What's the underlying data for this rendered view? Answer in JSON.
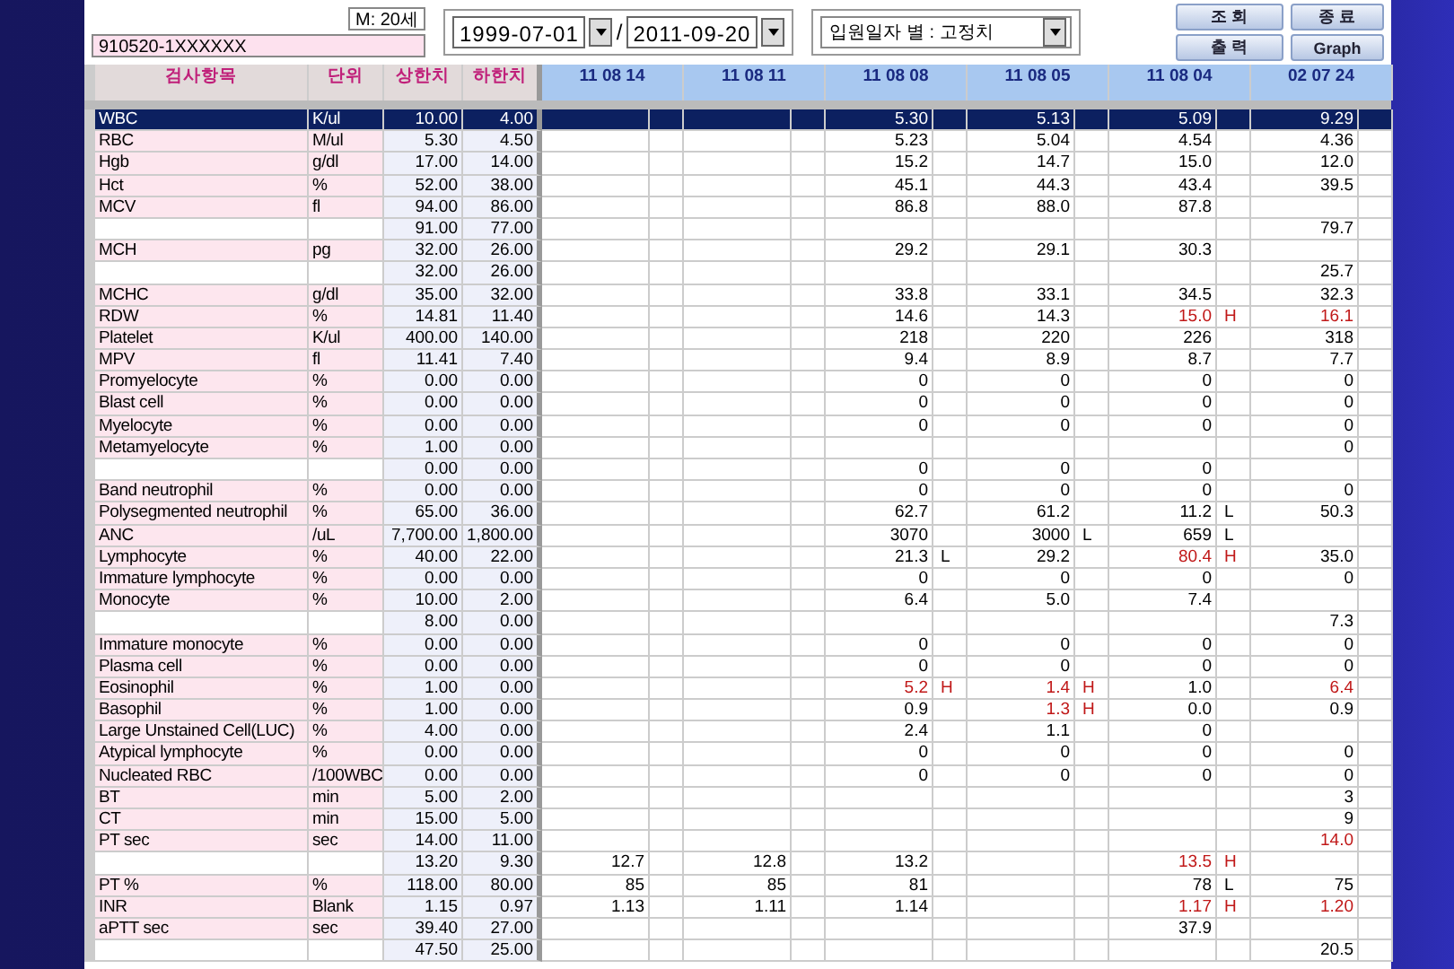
{
  "patient": {
    "sex_age": "M: 20세",
    "id_number": "910520-1XXXXXX"
  },
  "date_range": {
    "from": "1999-07-01",
    "separator": "/",
    "to": "2011-09-20"
  },
  "view_select": {
    "value": "입원일자 별 : 고정치"
  },
  "buttons": [
    {
      "label": "조 회"
    },
    {
      "label": "종 료"
    },
    {
      "label": "출 력"
    },
    {
      "label": "Graph"
    }
  ],
  "table": {
    "columns": [
      "검사항목",
      "단위",
      "상한치",
      "하한치"
    ],
    "dates": [
      "11 08 14",
      "11 08 11",
      "11 08 08",
      "11 08 05",
      "11 08 04",
      "02 07 24"
    ],
    "rows": [
      {
        "name": "WBC",
        "unit": "K/ul",
        "upper": "10.00",
        "lower": "4.00",
        "selected": true,
        "results": [
          {
            "kind": "blank"
          },
          {
            "kind": "blank"
          },
          {
            "kind": "value",
            "value": "5.30",
            "abnormal": false
          },
          {
            "kind": "value",
            "value": "5.13",
            "abnormal": false
          },
          {
            "kind": "value",
            "value": "5.09",
            "abnormal": false
          },
          {
            "kind": "value",
            "value": "9.29",
            "abnormal": false
          }
        ]
      },
      {
        "name": "RBC",
        "unit": "M/ul",
        "upper": "5.30",
        "lower": "4.50",
        "selected": false,
        "results": [
          {
            "kind": "blank"
          },
          {
            "kind": "blank"
          },
          {
            "kind": "value",
            "value": "5.23",
            "abnormal": false
          },
          {
            "kind": "value",
            "value": "5.04",
            "abnormal": false
          },
          {
            "kind": "value",
            "value": "4.54",
            "abnormal": false
          },
          {
            "kind": "value",
            "value": "4.36",
            "abnormal": false
          }
        ]
      },
      {
        "name": "Hgb",
        "unit": "g/dl",
        "upper": "17.00",
        "lower": "14.00",
        "selected": false,
        "results": [
          {
            "kind": "blank"
          },
          {
            "kind": "blank"
          },
          {
            "kind": "value",
            "value": "15.2",
            "abnormal": false
          },
          {
            "kind": "value",
            "value": "14.7",
            "abnormal": false
          },
          {
            "kind": "value",
            "value": "15.0",
            "abnormal": false
          },
          {
            "kind": "value",
            "value": "12.0",
            "abnormal": false
          }
        ]
      },
      {
        "name": "Hct",
        "unit": "%",
        "upper": "52.00",
        "lower": "38.00",
        "selected": false,
        "results": [
          {
            "kind": "blank"
          },
          {
            "kind": "blank"
          },
          {
            "kind": "value",
            "value": "45.1",
            "abnormal": false
          },
          {
            "kind": "value",
            "value": "44.3",
            "abnormal": false
          },
          {
            "kind": "value",
            "value": "43.4",
            "abnormal": false
          },
          {
            "kind": "value",
            "value": "39.5",
            "abnormal": false
          }
        ]
      },
      {
        "name": "MCV",
        "unit": "fl",
        "upper": "94.00",
        "lower": "86.00",
        "selected": false,
        "results": [
          {
            "kind": "blank"
          },
          {
            "kind": "blank"
          },
          {
            "kind": "value",
            "value": "86.8",
            "abnormal": false
          },
          {
            "kind": "value",
            "value": "88.0",
            "abnormal": false
          },
          {
            "kind": "value",
            "value": "87.8",
            "abnormal": false
          },
          {
            "kind": "blank"
          }
        ]
      },
      {
        "upper": "91.00",
        "lower": "77.00",
        "selected": false,
        "results": [
          {
            "kind": "blank"
          },
          {
            "kind": "blank"
          },
          {
            "kind": "blank"
          },
          {
            "kind": "blank"
          },
          {
            "kind": "blank"
          },
          {
            "kind": "value",
            "value": "79.7",
            "abnormal": false
          }
        ]
      },
      {
        "name": "MCH",
        "unit": "pg",
        "upper": "32.00",
        "lower": "26.00",
        "selected": false,
        "results": [
          {
            "kind": "blank"
          },
          {
            "kind": "blank"
          },
          {
            "kind": "value",
            "value": "29.2",
            "abnormal": false
          },
          {
            "kind": "value",
            "value": "29.1",
            "abnormal": false
          },
          {
            "kind": "value",
            "value": "30.3",
            "abnormal": false
          },
          {
            "kind": "blank"
          }
        ]
      },
      {
        "upper": "32.00",
        "lower": "26.00",
        "selected": false,
        "results": [
          {
            "kind": "blank"
          },
          {
            "kind": "blank"
          },
          {
            "kind": "blank"
          },
          {
            "kind": "blank"
          },
          {
            "kind": "blank"
          },
          {
            "kind": "value",
            "value": "25.7",
            "abnormal": false
          }
        ]
      },
      {
        "name": "MCHC",
        "unit": "g/dl",
        "upper": "35.00",
        "lower": "32.00",
        "selected": false,
        "results": [
          {
            "kind": "blank"
          },
          {
            "kind": "blank"
          },
          {
            "kind": "value",
            "value": "33.8",
            "abnormal": false
          },
          {
            "kind": "value",
            "value": "33.1",
            "abnormal": false
          },
          {
            "kind": "value",
            "value": "34.5",
            "abnormal": false
          },
          {
            "kind": "value",
            "value": "32.3",
            "abnormal": false
          }
        ]
      },
      {
        "name": "RDW",
        "unit": "%",
        "upper": "14.81",
        "lower": "11.40",
        "selected": false,
        "results": [
          {
            "kind": "blank"
          },
          {
            "kind": "blank"
          },
          {
            "kind": "value",
            "value": "14.6",
            "abnormal": false
          },
          {
            "kind": "value",
            "value": "14.3",
            "abnormal": false
          },
          {
            "kind": "value",
            "value": "15.0",
            "flag": "H",
            "abnormal": true
          },
          {
            "kind": "value",
            "value": "16.1",
            "abnormal": true
          }
        ]
      },
      {
        "name": "Platelet",
        "unit": "K/ul",
        "upper": "400.00",
        "lower": "140.00",
        "selected": false,
        "results": [
          {
            "kind": "blank"
          },
          {
            "kind": "blank"
          },
          {
            "kind": "value",
            "value": "218",
            "abnormal": false
          },
          {
            "kind": "value",
            "value": "220",
            "abnormal": false
          },
          {
            "kind": "value",
            "value": "226",
            "abnormal": false
          },
          {
            "kind": "value",
            "value": "318",
            "abnormal": false
          }
        ]
      },
      {
        "name": "MPV",
        "unit": "fl",
        "upper": "11.41",
        "lower": "7.40",
        "selected": false,
        "results": [
          {
            "kind": "blank"
          },
          {
            "kind": "blank"
          },
          {
            "kind": "value",
            "value": "9.4",
            "abnormal": false
          },
          {
            "kind": "value",
            "value": "8.9",
            "abnormal": false
          },
          {
            "kind": "value",
            "value": "8.7",
            "abnormal": false
          },
          {
            "kind": "value",
            "value": "7.7",
            "abnormal": false
          }
        ]
      },
      {
        "name": "Promyelocyte",
        "unit": "%",
        "upper": "0.00",
        "lower": "0.00",
        "selected": false,
        "results": [
          {
            "kind": "blank"
          },
          {
            "kind": "blank"
          },
          {
            "kind": "value",
            "value": "0",
            "abnormal": false
          },
          {
            "kind": "value",
            "value": "0",
            "abnormal": false
          },
          {
            "kind": "value",
            "value": "0",
            "abnormal": false
          },
          {
            "kind": "value",
            "value": "0",
            "abnormal": false
          }
        ]
      },
      {
        "name": "Blast cell",
        "unit": "%",
        "upper": "0.00",
        "lower": "0.00",
        "selected": false,
        "results": [
          {
            "kind": "blank"
          },
          {
            "kind": "blank"
          },
          {
            "kind": "value",
            "value": "0",
            "abnormal": false
          },
          {
            "kind": "value",
            "value": "0",
            "abnormal": false
          },
          {
            "kind": "value",
            "value": "0",
            "abnormal": false
          },
          {
            "kind": "value",
            "value": "0",
            "abnormal": false
          }
        ]
      },
      {
        "name": "Myelocyte",
        "unit": "%",
        "upper": "0.00",
        "lower": "0.00",
        "selected": false,
        "results": [
          {
            "kind": "blank"
          },
          {
            "kind": "blank"
          },
          {
            "kind": "value",
            "value": "0",
            "abnormal": false
          },
          {
            "kind": "value",
            "value": "0",
            "abnormal": false
          },
          {
            "kind": "value",
            "value": "0",
            "abnormal": false
          },
          {
            "kind": "value",
            "value": "0",
            "abnormal": false
          }
        ]
      },
      {
        "name": "Metamyelocyte",
        "unit": "%",
        "upper": "1.00",
        "lower": "0.00",
        "selected": false,
        "results": [
          {
            "kind": "blank"
          },
          {
            "kind": "blank"
          },
          {
            "kind": "blank"
          },
          {
            "kind": "blank"
          },
          {
            "kind": "blank"
          },
          {
            "kind": "value",
            "value": "0",
            "abnormal": false
          }
        ]
      },
      {
        "upper": "0.00",
        "lower": "0.00",
        "selected": false,
        "results": [
          {
            "kind": "blank"
          },
          {
            "kind": "blank"
          },
          {
            "kind": "value",
            "value": "0",
            "abnormal": false
          },
          {
            "kind": "value",
            "value": "0",
            "abnormal": false
          },
          {
            "kind": "value",
            "value": "0",
            "abnormal": false
          },
          {
            "kind": "blank"
          }
        ]
      },
      {
        "name": "Band neutrophil",
        "unit": "%",
        "upper": "0.00",
        "lower": "0.00",
        "selected": false,
        "results": [
          {
            "kind": "blank"
          },
          {
            "kind": "blank"
          },
          {
            "kind": "value",
            "value": "0",
            "abnormal": false
          },
          {
            "kind": "value",
            "value": "0",
            "abnormal": false
          },
          {
            "kind": "value",
            "value": "0",
            "abnormal": false
          },
          {
            "kind": "value",
            "value": "0",
            "abnormal": false
          }
        ]
      },
      {
        "name": "Polysegmented neutrophil",
        "unit": "%",
        "upper": "65.00",
        "lower": "36.00",
        "selected": false,
        "results": [
          {
            "kind": "blank"
          },
          {
            "kind": "blank"
          },
          {
            "kind": "value",
            "value": "62.7",
            "abnormal": false
          },
          {
            "kind": "value",
            "value": "61.2",
            "abnormal": false
          },
          {
            "kind": "value",
            "value": "11.2",
            "flag": "L",
            "abnormal": false
          },
          {
            "kind": "value",
            "value": "50.3",
            "abnormal": false
          }
        ]
      },
      {
        "name": "ANC",
        "unit": "/uL",
        "upper": "7,700.00",
        "lower": "1,800.00",
        "selected": false,
        "results": [
          {
            "kind": "blank"
          },
          {
            "kind": "blank"
          },
          {
            "kind": "value",
            "value": "3070",
            "abnormal": false
          },
          {
            "kind": "value",
            "value": "3000",
            "flag": "L",
            "abnormal": false
          },
          {
            "kind": "value",
            "value": "659",
            "flag": "L",
            "abnormal": false
          },
          {
            "kind": "blank"
          }
        ]
      },
      {
        "name": "Lymphocyte",
        "unit": "%",
        "upper": "40.00",
        "lower": "22.00",
        "selected": false,
        "results": [
          {
            "kind": "blank"
          },
          {
            "kind": "blank"
          },
          {
            "kind": "value",
            "value": "21.3",
            "flag": "L",
            "abnormal": false
          },
          {
            "kind": "value",
            "value": "29.2",
            "abnormal": false
          },
          {
            "kind": "value",
            "value": "80.4",
            "flag": "H",
            "abnormal": true
          },
          {
            "kind": "value",
            "value": "35.0",
            "abnormal": false
          }
        ]
      },
      {
        "name": "Immature lymphocyte",
        "unit": "%",
        "upper": "0.00",
        "lower": "0.00",
        "selected": false,
        "results": [
          {
            "kind": "blank"
          },
          {
            "kind": "blank"
          },
          {
            "kind": "value",
            "value": "0",
            "abnormal": false
          },
          {
            "kind": "value",
            "value": "0",
            "abnormal": false
          },
          {
            "kind": "value",
            "value": "0",
            "abnormal": false
          },
          {
            "kind": "value",
            "value": "0",
            "abnormal": false
          }
        ]
      },
      {
        "name": "Monocyte",
        "unit": "%",
        "upper": "10.00",
        "lower": "2.00",
        "selected": false,
        "results": [
          {
            "kind": "blank"
          },
          {
            "kind": "blank"
          },
          {
            "kind": "value",
            "value": "6.4",
            "abnormal": false
          },
          {
            "kind": "value",
            "value": "5.0",
            "abnormal": false
          },
          {
            "kind": "value",
            "value": "7.4",
            "abnormal": false
          },
          {
            "kind": "blank"
          }
        ]
      },
      {
        "upper": "8.00",
        "lower": "0.00",
        "selected": false,
        "results": [
          {
            "kind": "blank"
          },
          {
            "kind": "blank"
          },
          {
            "kind": "blank"
          },
          {
            "kind": "blank"
          },
          {
            "kind": "blank"
          },
          {
            "kind": "value",
            "value": "7.3",
            "abnormal": false
          }
        ]
      },
      {
        "name": "Immature monocyte",
        "unit": "%",
        "upper": "0.00",
        "lower": "0.00",
        "selected": false,
        "results": [
          {
            "kind": "blank"
          },
          {
            "kind": "blank"
          },
          {
            "kind": "value",
            "value": "0",
            "abnormal": false
          },
          {
            "kind": "value",
            "value": "0",
            "abnormal": false
          },
          {
            "kind": "value",
            "value": "0",
            "abnormal": false
          },
          {
            "kind": "value",
            "value": "0",
            "abnormal": false
          }
        ]
      },
      {
        "name": "Plasma cell",
        "unit": "%",
        "upper": "0.00",
        "lower": "0.00",
        "selected": false,
        "results": [
          {
            "kind": "blank"
          },
          {
            "kind": "blank"
          },
          {
            "kind": "value",
            "value": "0",
            "abnormal": false
          },
          {
            "kind": "value",
            "value": "0",
            "abnormal": false
          },
          {
            "kind": "value",
            "value": "0",
            "abnormal": false
          },
          {
            "kind": "value",
            "value": "0",
            "abnormal": false
          }
        ]
      },
      {
        "name": "Eosinophil",
        "unit": "%",
        "upper": "1.00",
        "lower": "0.00",
        "selected": false,
        "results": [
          {
            "kind": "blank"
          },
          {
            "kind": "blank"
          },
          {
            "kind": "value",
            "value": "5.2",
            "flag": "H",
            "abnormal": true
          },
          {
            "kind": "value",
            "value": "1.4",
            "flag": "H",
            "abnormal": true
          },
          {
            "kind": "value",
            "value": "1.0",
            "abnormal": false
          },
          {
            "kind": "value",
            "value": "6.4",
            "abnormal": true
          }
        ]
      },
      {
        "name": "Basophil",
        "unit": "%",
        "upper": "1.00",
        "lower": "0.00",
        "selected": false,
        "results": [
          {
            "kind": "blank"
          },
          {
            "kind": "blank"
          },
          {
            "kind": "value",
            "value": "0.9",
            "abnormal": false
          },
          {
            "kind": "value",
            "value": "1.3",
            "flag": "H",
            "abnormal": true
          },
          {
            "kind": "value",
            "value": "0.0",
            "abnormal": false
          },
          {
            "kind": "value",
            "value": "0.9",
            "abnormal": false
          }
        ]
      },
      {
        "name": "Large Unstained Cell(LUC)",
        "unit": "%",
        "upper": "4.00",
        "lower": "0.00",
        "selected": false,
        "results": [
          {
            "kind": "blank"
          },
          {
            "kind": "blank"
          },
          {
            "kind": "value",
            "value": "2.4",
            "abnormal": false
          },
          {
            "kind": "value",
            "value": "1.1",
            "abnormal": false
          },
          {
            "kind": "value",
            "value": "0",
            "abnormal": false
          },
          {
            "kind": "blank"
          }
        ]
      },
      {
        "name": "Atypical lymphocyte",
        "unit": "%",
        "upper": "0.00",
        "lower": "0.00",
        "selected": false,
        "results": [
          {
            "kind": "blank"
          },
          {
            "kind": "blank"
          },
          {
            "kind": "value",
            "value": "0",
            "abnormal": false
          },
          {
            "kind": "value",
            "value": "0",
            "abnormal": false
          },
          {
            "kind": "value",
            "value": "0",
            "abnormal": false
          },
          {
            "kind": "value",
            "value": "0",
            "abnormal": false
          }
        ]
      },
      {
        "name": "Nucleated RBC",
        "unit": "/100WBC",
        "upper": "0.00",
        "lower": "0.00",
        "selected": false,
        "results": [
          {
            "kind": "blank"
          },
          {
            "kind": "blank"
          },
          {
            "kind": "value",
            "value": "0",
            "abnormal": false
          },
          {
            "kind": "value",
            "value": "0",
            "abnormal": false
          },
          {
            "kind": "value",
            "value": "0",
            "abnormal": false
          },
          {
            "kind": "value",
            "value": "0",
            "abnormal": false
          }
        ]
      },
      {
        "name": "BT",
        "unit": "min",
        "upper": "5.00",
        "lower": "2.00",
        "selected": false,
        "results": [
          {
            "kind": "blank"
          },
          {
            "kind": "blank"
          },
          {
            "kind": "blank"
          },
          {
            "kind": "blank"
          },
          {
            "kind": "blank"
          },
          {
            "kind": "value",
            "value": "3",
            "abnormal": false
          }
        ]
      },
      {
        "name": "CT",
        "unit": "min",
        "upper": "15.00",
        "lower": "5.00",
        "selected": false,
        "results": [
          {
            "kind": "blank"
          },
          {
            "kind": "blank"
          },
          {
            "kind": "blank"
          },
          {
            "kind": "blank"
          },
          {
            "kind": "blank"
          },
          {
            "kind": "value",
            "value": "9",
            "abnormal": false
          }
        ]
      },
      {
        "name": "PT sec",
        "unit": "sec",
        "upper": "14.00",
        "lower": "11.00",
        "selected": false,
        "results": [
          {
            "kind": "blank"
          },
          {
            "kind": "blank"
          },
          {
            "kind": "blank"
          },
          {
            "kind": "blank"
          },
          {
            "kind": "blank"
          },
          {
            "kind": "value",
            "value": "14.0",
            "abnormal": true
          }
        ]
      },
      {
        "upper": "13.20",
        "lower": "9.30",
        "selected": false,
        "results": [
          {
            "kind": "value",
            "value": "12.7",
            "abnormal": false
          },
          {
            "kind": "value",
            "value": "12.8",
            "abnormal": false
          },
          {
            "kind": "value",
            "value": "13.2",
            "abnormal": false
          },
          {
            "kind": "blank"
          },
          {
            "kind": "value",
            "value": "13.5",
            "flag": "H",
            "abnormal": true
          },
          {
            "kind": "blank"
          }
        ]
      },
      {
        "name": "PT %",
        "unit": "%",
        "upper": "118.00",
        "lower": "80.00",
        "selected": false,
        "results": [
          {
            "kind": "value",
            "value": "85",
            "abnormal": false
          },
          {
            "kind": "value",
            "value": "85",
            "abnormal": false
          },
          {
            "kind": "value",
            "value": "81",
            "abnormal": false
          },
          {
            "kind": "blank"
          },
          {
            "kind": "value",
            "value": "78",
            "flag": "L",
            "abnormal": false
          },
          {
            "kind": "value",
            "value": "75",
            "abnormal": false
          }
        ]
      },
      {
        "name": "INR",
        "unit": "Blank",
        "upper": "1.15",
        "lower": "0.97",
        "selected": false,
        "results": [
          {
            "kind": "value",
            "value": "1.13",
            "abnormal": false
          },
          {
            "kind": "value",
            "value": "1.11",
            "abnormal": false
          },
          {
            "kind": "value",
            "value": "1.14",
            "abnormal": false
          },
          {
            "kind": "blank"
          },
          {
            "kind": "value",
            "value": "1.17",
            "flag": "H",
            "abnormal": true
          },
          {
            "kind": "value",
            "value": "1.20",
            "abnormal": true
          }
        ]
      },
      {
        "name": "aPTT sec",
        "unit": "sec",
        "upper": "39.40",
        "lower": "27.00",
        "selected": false,
        "results": [
          {
            "kind": "blank"
          },
          {
            "kind": "blank"
          },
          {
            "kind": "blank"
          },
          {
            "kind": "blank"
          },
          {
            "kind": "value",
            "value": "37.9",
            "abnormal": false
          },
          {
            "kind": "blank"
          }
        ]
      },
      {
        "upper": "47.50",
        "lower": "25.00",
        "selected": false,
        "results": [
          {
            "kind": "blank"
          },
          {
            "kind": "blank"
          },
          {
            "kind": "blank"
          },
          {
            "kind": "blank"
          },
          {
            "kind": "blank"
          },
          {
            "kind": "value",
            "value": "20.5",
            "abnormal": false
          }
        ]
      }
    ]
  }
}
